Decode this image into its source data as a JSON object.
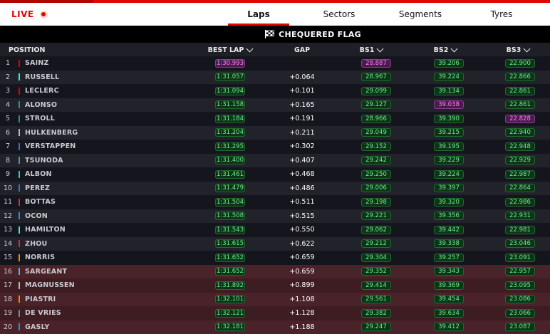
{
  "header": {
    "live_label": "LIVE",
    "tabs": [
      {
        "label": "Laps",
        "active": true
      },
      {
        "label": "Sectors",
        "active": false
      },
      {
        "label": "Segments",
        "active": false
      },
      {
        "label": "Tyres",
        "active": false
      }
    ],
    "status": "CHEQUERED FLAG",
    "status_icon": "chequered-flag-icon"
  },
  "columns": {
    "position": "POSITION",
    "best_lap": "BEST LAP",
    "gap": "GAP",
    "bs1": "BS1",
    "bs2": "BS2",
    "bs3": "BS3"
  },
  "colors": {
    "accent": "#e10600",
    "personal_best": "#69f08e",
    "overall_best": "#ff7cf6",
    "elimination_zone": "#3d1c22"
  },
  "drivers": [
    {
      "pos": "1",
      "name": "SAINZ",
      "team_color": "#dc0000",
      "best": "1:30.993",
      "best_type": "p",
      "gap": "",
      "bs1": "28.887",
      "bs1_type": "p",
      "bs2": "39.206",
      "bs2_type": "g",
      "bs3": "22.900",
      "bs3_type": "g"
    },
    {
      "pos": "2",
      "name": "RUSSELL",
      "team_color": "#27f4d2",
      "best": "1:31.057",
      "best_type": "g",
      "gap": "+0.064",
      "bs1": "28.967",
      "bs1_type": "g",
      "bs2": "39.224",
      "bs2_type": "g",
      "bs3": "22.866",
      "bs3_type": "g"
    },
    {
      "pos": "3",
      "name": "LECLERC",
      "team_color": "#dc0000",
      "best": "1:31.094",
      "best_type": "g",
      "gap": "+0.101",
      "bs1": "29.099",
      "bs1_type": "g",
      "bs2": "39.134",
      "bs2_type": "g",
      "bs3": "22.861",
      "bs3_type": "g"
    },
    {
      "pos": "4",
      "name": "ALONSO",
      "team_color": "#229971",
      "best": "1:31.158",
      "best_type": "g",
      "gap": "+0.165",
      "bs1": "29.127",
      "bs1_type": "g",
      "bs2": "39.038",
      "bs2_type": "p",
      "bs3": "22.861",
      "bs3_type": "g"
    },
    {
      "pos": "5",
      "name": "STROLL",
      "team_color": "#229971",
      "best": "1:31.184",
      "best_type": "g",
      "gap": "+0.191",
      "bs1": "28.966",
      "bs1_type": "g",
      "bs2": "39.390",
      "bs2_type": "g",
      "bs3": "22.828",
      "bs3_type": "p"
    },
    {
      "pos": "6",
      "name": "HULKENBERG",
      "team_color": "#b6babd",
      "best": "1:31.204",
      "best_type": "g",
      "gap": "+0.211",
      "bs1": "29.049",
      "bs1_type": "g",
      "bs2": "39.215",
      "bs2_type": "g",
      "bs3": "22.940",
      "bs3_type": "g"
    },
    {
      "pos": "7",
      "name": "VERSTAPPEN",
      "team_color": "#3671c6",
      "best": "1:31.295",
      "best_type": "g",
      "gap": "+0.302",
      "bs1": "29.152",
      "bs1_type": "g",
      "bs2": "39.195",
      "bs2_type": "g",
      "bs3": "22.948",
      "bs3_type": "g"
    },
    {
      "pos": "8",
      "name": "TSUNODA",
      "team_color": "#5e8faa",
      "best": "1:31.400",
      "best_type": "g",
      "gap": "+0.407",
      "bs1": "29.242",
      "bs1_type": "g",
      "bs2": "39.229",
      "bs2_type": "g",
      "bs3": "22.929",
      "bs3_type": "g"
    },
    {
      "pos": "9",
      "name": "ALBON",
      "team_color": "#37bedd",
      "best": "1:31.461",
      "best_type": "g",
      "gap": "+0.468",
      "bs1": "29.250",
      "bs1_type": "g",
      "bs2": "39.224",
      "bs2_type": "g",
      "bs3": "22.987",
      "bs3_type": "g"
    },
    {
      "pos": "10",
      "name": "PEREZ",
      "team_color": "#3671c6",
      "best": "1:31.479",
      "best_type": "g",
      "gap": "+0.486",
      "bs1": "29.006",
      "bs1_type": "g",
      "bs2": "39.397",
      "bs2_type": "g",
      "bs3": "22.864",
      "bs3_type": "g"
    },
    {
      "pos": "11",
      "name": "BOTTAS",
      "team_color": "#c92d4b",
      "best": "1:31.504",
      "best_type": "g",
      "gap": "+0.511",
      "bs1": "29.198",
      "bs1_type": "g",
      "bs2": "39.320",
      "bs2_type": "g",
      "bs3": "22.986",
      "bs3_type": "g"
    },
    {
      "pos": "12",
      "name": "OCON",
      "team_color": "#2293d1",
      "best": "1:31.508",
      "best_type": "g",
      "gap": "+0.515",
      "bs1": "29.221",
      "bs1_type": "g",
      "bs2": "39.356",
      "bs2_type": "g",
      "bs3": "22.931",
      "bs3_type": "g"
    },
    {
      "pos": "13",
      "name": "HAMILTON",
      "team_color": "#27f4d2",
      "best": "1:31.543",
      "best_type": "g",
      "gap": "+0.550",
      "bs1": "29.062",
      "bs1_type": "g",
      "bs2": "39.442",
      "bs2_type": "g",
      "bs3": "22.981",
      "bs3_type": "g"
    },
    {
      "pos": "14",
      "name": "ZHOU",
      "team_color": "#c92d4b",
      "best": "1:31.615",
      "best_type": "g",
      "gap": "+0.622",
      "bs1": "29.212",
      "bs1_type": "g",
      "bs2": "39.338",
      "bs2_type": "g",
      "bs3": "23.046",
      "bs3_type": "g"
    },
    {
      "pos": "15",
      "name": "NORRIS",
      "team_color": "#ff8000",
      "best": "1:31.652",
      "best_type": "g",
      "gap": "+0.659",
      "bs1": "29.304",
      "bs1_type": "g",
      "bs2": "39.257",
      "bs2_type": "g",
      "bs3": "23.091",
      "bs3_type": "g"
    },
    {
      "pos": "16",
      "name": "SARGEANT",
      "team_color": "#37bedd",
      "best": "1:31.652",
      "best_type": "g",
      "gap": "+0.659",
      "bs1": "29.352",
      "bs1_type": "g",
      "bs2": "39.343",
      "bs2_type": "g",
      "bs3": "22.957",
      "bs3_type": "g"
    },
    {
      "pos": "17",
      "name": "MAGNUSSEN",
      "team_color": "#b6babd",
      "best": "1:31.892",
      "best_type": "g",
      "gap": "+0.899",
      "bs1": "29.414",
      "bs1_type": "g",
      "bs2": "39.369",
      "bs2_type": "g",
      "bs3": "23.095",
      "bs3_type": "g"
    },
    {
      "pos": "18",
      "name": "PIASTRI",
      "team_color": "#ff8000",
      "best": "1:32.101",
      "best_type": "g",
      "gap": "+1.108",
      "bs1": "29.561",
      "bs1_type": "g",
      "bs2": "39.454",
      "bs2_type": "g",
      "bs3": "23.086",
      "bs3_type": "g"
    },
    {
      "pos": "19",
      "name": "DE VRIES",
      "team_color": "#5e8faa",
      "best": "1:32.121",
      "best_type": "g",
      "gap": "+1.128",
      "bs1": "29.382",
      "bs1_type": "g",
      "bs2": "39.634",
      "bs2_type": "g",
      "bs3": "23.066",
      "bs3_type": "g"
    },
    {
      "pos": "20",
      "name": "GASLY",
      "team_color": "#2293d1",
      "best": "1:32.181",
      "best_type": "g",
      "gap": "+1.188",
      "bs1": "29.247",
      "bs1_type": "g",
      "bs2": "39.412",
      "bs2_type": "g",
      "bs3": "23.087",
      "bs3_type": "g"
    }
  ]
}
